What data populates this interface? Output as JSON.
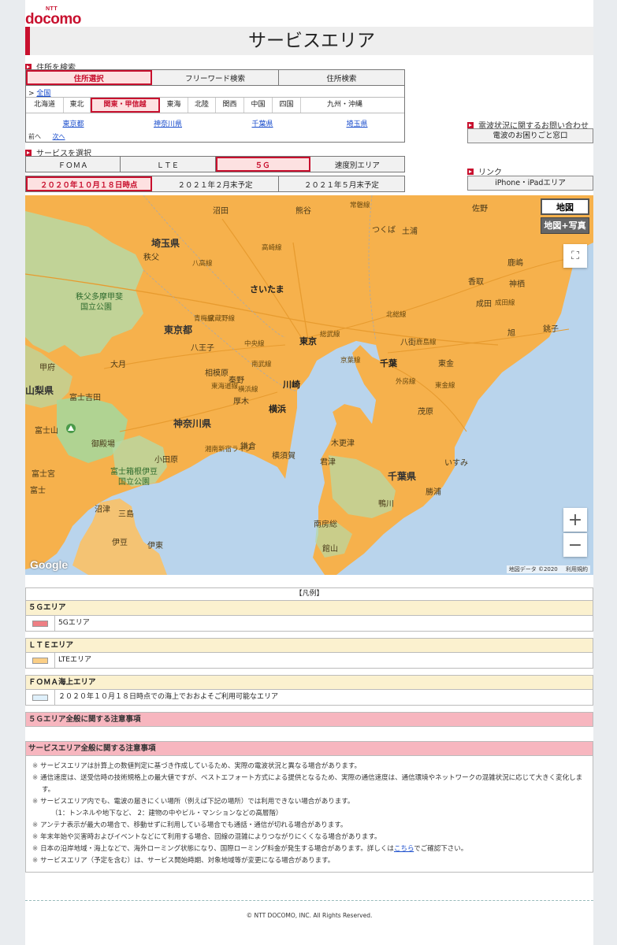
{
  "brand": {
    "ntt": "NTT",
    "name": "docomo"
  },
  "page_title": "サービスエリア",
  "address_section": {
    "label": "住所を検索",
    "tabs": [
      {
        "label": "住所選択",
        "active": true
      },
      {
        "label": "フリーワード検索",
        "active": false
      },
      {
        "label": "住所検索",
        "active": false
      }
    ],
    "breadcrumb_prefix": ">",
    "breadcrumb_link": "全国",
    "regions": [
      {
        "label": "北海道",
        "active": false
      },
      {
        "label": "東北",
        "active": false
      },
      {
        "label": "関東・甲信越",
        "active": true
      },
      {
        "label": "東海",
        "active": false
      },
      {
        "label": "北陸",
        "active": false
      },
      {
        "label": "関西",
        "active": false
      },
      {
        "label": "中国",
        "active": false
      },
      {
        "label": "四国",
        "active": false
      },
      {
        "label": "九州・沖縄",
        "active": false
      }
    ],
    "prefectures": [
      "東京都",
      "神奈川県",
      "千葉県",
      "埼玉県"
    ],
    "prev_label": "前へ",
    "next_label": "次へ"
  },
  "service_section": {
    "label": "サービスを選択",
    "tabs": [
      {
        "label": "ＦＯＭＡ",
        "active": false
      },
      {
        "label": "ＬＴＥ",
        "active": false
      },
      {
        "label": "５Ｇ",
        "active": true
      },
      {
        "label": "速度別エリア",
        "active": false
      }
    ],
    "dates": [
      {
        "label": "２０２０年１０月１８日時点",
        "active": true
      },
      {
        "label": "２０２１年２月末予定",
        "active": false
      },
      {
        "label": "２０２１年５月末予定",
        "active": false
      }
    ]
  },
  "side": {
    "inquiry_label": "電波状況に関するお問い合わせ",
    "inquiry_button": "電波のお困りごと窓口",
    "link_label": "リンク",
    "link_button": "iPhone・iPadエリア"
  },
  "map": {
    "type_map": "地図",
    "type_photo": "地図+写真",
    "fullscreen_glyph": "⛶",
    "zoom_in": "+",
    "zoom_out": "−",
    "google": "Google",
    "attribution": "地図データ ©2020",
    "terms": "利用規約",
    "labels": {
      "numata": "沼田",
      "kumagaya": "熊谷",
      "tsukuba": "つくば",
      "tsuchiura": "土浦",
      "saitama_pref": "埼玉県",
      "chichibu": "秩父",
      "saitama_city": "さいたま",
      "park_chichibu1": "秩父多摩甲斐",
      "park_chichibu2": "国立公園",
      "tokyo_pref": "東京都",
      "hachioji": "八王子",
      "tokyo": "東京",
      "chiba": "千葉",
      "kofu": "甲府",
      "otsuki": "大月",
      "sagamihara": "相模原",
      "kawasaki": "川崎",
      "yokohama": "横浜",
      "yamanashi": "山梨県",
      "fujiyoshida": "富士吉田",
      "kanagawa_pref": "神奈川県",
      "mtfuji": "富士山",
      "gotemba": "御殿場",
      "odawara": "小田原",
      "yokosuka": "横須賀",
      "kisarazu": "木更津",
      "kimitsu": "君津",
      "fujinomiya": "富士宮",
      "park_hakone1": "富士箱根伊豆",
      "park_hakone2": "国立公園",
      "chiba_pref": "千葉県",
      "isumi": "いすみ",
      "katsuura": "勝浦",
      "kamogawa": "鴨川",
      "minamiboso": "南房総",
      "tateyama": "館山",
      "numazu": "沼津",
      "mishima": "三島",
      "ito": "伊東",
      "izu": "伊豆",
      "fuji": "富士",
      "sano": "佐野",
      "kashima": "鹿嶋",
      "kamisu": "神栖",
      "katori": "香取",
      "narita": "成田",
      "asahi": "旭",
      "choshi": "銚子",
      "yachimata": "八街",
      "togane": "東金",
      "mobara": "茂原",
      "hikone": "秦野",
      "atsugi": "厚木",
      "kamakura": "鎌倉",
      "rail_sobu": "総武線",
      "rail_chuo": "中央線",
      "rail_keiyo": "京葉線",
      "rail_nanbu": "南武線",
      "rail_yokohama": "横浜線",
      "rail_shonan": "湘南新宿ライン",
      "rail_musashino": "武蔵野線",
      "rail_joban": "常磐線",
      "rail_takasaki": "高崎線",
      "rail_hachiko": "八高線",
      "rail_ome": "青梅線",
      "rail_sotobo": "外房線",
      "rail_togane": "東金線",
      "rail_narita": "成田線",
      "rail_kashima": "鹿島線",
      "rail_hokuso": "北総線",
      "rail_tokaido": "東海道線"
    }
  },
  "legend": {
    "header": "【凡例】",
    "categories": [
      {
        "title": "５Ｇエリア",
        "item": "5Gエリア",
        "color": "#ee7f84"
      },
      {
        "title": "ＬＴＥエリア",
        "item": "LTEエリア",
        "color": "#fbcf86"
      },
      {
        "title": "ＦＯＭＡ海上エリア",
        "item": "２０２０年１０月１８日時点での海上でおおよそご利用可能なエリア",
        "color": "#dff0fb"
      }
    ],
    "notice_5g": "５Ｇエリア全般に関する注意事項",
    "notice_general": "サービスエリア全般に関する注意事項",
    "note_mark": "※",
    "notes": [
      "サービスエリアは計算上の数値判定に基づき作成しているため、実際の電波状況と異なる場合があります。",
      "通信速度は、送受信時の技術規格上の最大値ですが、ベストエフォート方式による提供となるため、実際の通信速度は、通信環境やネットワークの混雑状況に応じて大きく変化します。",
      "サービスエリア内でも、電波の届きにくい場所（例えば下記の場所）では利用できない場合があります。",
      "アンテナ表示が最大の場合で、移動せずに利用している場合でも通話・通信が切れる場合があります。",
      "年末年始や災害時およびイベントなどにて利用する場合、回線の混雑によりつながりにくくなる場合があります。",
      "サービスエリア（予定を含む）は、サービス開始時期、対象地域等が変更になる場合があります。"
    ],
    "note_sub": "（1：トンネルや地下など、 2：建物の中やビル・マンションなどの高層階）",
    "note_roaming_pre": "日本の沿岸地域・海上などで、海外ローミング状態になり、国際ローミング料金が発生する場合があります。詳しくは",
    "note_roaming_link": "こちら",
    "note_roaming_post": "でご確認下さい。"
  },
  "footer": {
    "copyright": "© NTT DOCOMO, INC. All Rights Reserved."
  },
  "colors": {
    "brand_red": "#c8102e",
    "lte_orange": "#f6b14c",
    "sea": "#b9d4ec",
    "green": "#a9d7a9"
  }
}
